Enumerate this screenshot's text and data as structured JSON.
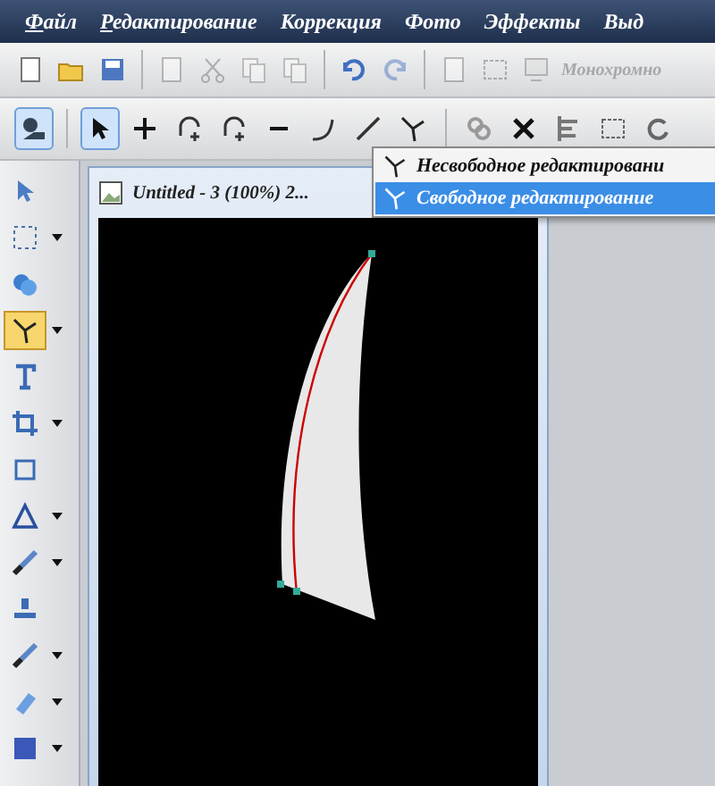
{
  "menu_bar": {
    "items": [
      {
        "accel": "Ф",
        "label": "айл"
      },
      {
        "accel": "Р",
        "label": "едактирование"
      },
      {
        "label": "Коррекция"
      },
      {
        "label": "Фото"
      },
      {
        "label": "Эффекты"
      },
      {
        "label": "Выд"
      }
    ]
  },
  "main_toolbar": {
    "buttons": [
      {
        "kind": "new",
        "disabled": false
      },
      {
        "kind": "open",
        "disabled": false
      },
      {
        "kind": "save",
        "disabled": false
      },
      {
        "kind": "blank",
        "disabled": true
      },
      {
        "kind": "cut",
        "disabled": true
      },
      {
        "kind": "copy",
        "disabled": true
      },
      {
        "kind": "paste",
        "disabled": true
      },
      {
        "kind": "undo",
        "disabled": false
      },
      {
        "kind": "redo",
        "disabled": true
      },
      {
        "kind": "page",
        "disabled": true
      },
      {
        "kind": "frame",
        "disabled": true
      },
      {
        "kind": "monitor",
        "disabled": true
      }
    ],
    "text": "Монохромно"
  },
  "path_toolbar": {
    "buttons": [
      {
        "kind": "mode",
        "selected": true
      },
      {
        "kind": "arrow",
        "selected": true
      },
      {
        "kind": "plus",
        "selected": false
      },
      {
        "kind": "addloop",
        "selected": false
      },
      {
        "kind": "addloop2",
        "selected": false
      },
      {
        "kind": "minus",
        "selected": false
      },
      {
        "kind": "curve",
        "selected": false
      },
      {
        "kind": "line",
        "selected": false
      },
      {
        "kind": "node",
        "selected": false
      },
      {
        "kind": "link",
        "selected": false
      },
      {
        "kind": "delete",
        "selected": false
      },
      {
        "kind": "align",
        "selected": false
      },
      {
        "kind": "select",
        "selected": false
      },
      {
        "kind": "refresh",
        "selected": false
      }
    ]
  },
  "dropdown": {
    "items": [
      {
        "label": "Несвободное редактировани",
        "selected": false
      },
      {
        "label": "Свободное редактирование",
        "selected": true
      }
    ]
  },
  "tools": {
    "items": [
      {
        "kind": "pointer",
        "selected": false,
        "has_menu": false
      },
      {
        "kind": "marquee",
        "selected": false,
        "has_menu": true
      },
      {
        "kind": "shapes",
        "selected": false,
        "has_menu": false
      },
      {
        "kind": "node",
        "selected": true,
        "has_menu": true
      },
      {
        "kind": "text",
        "selected": false,
        "has_menu": false
      },
      {
        "kind": "crop",
        "selected": false,
        "has_menu": true
      },
      {
        "kind": "transform",
        "selected": false,
        "has_menu": false
      },
      {
        "kind": "triangle",
        "selected": false,
        "has_menu": true
      },
      {
        "kind": "brush",
        "selected": false,
        "has_menu": true
      },
      {
        "kind": "stamp",
        "selected": false,
        "has_menu": false
      },
      {
        "kind": "wand",
        "selected": false,
        "has_menu": true
      },
      {
        "kind": "eraser",
        "selected": false,
        "has_menu": true
      },
      {
        "kind": "fill",
        "selected": false,
        "has_menu": true
      }
    ]
  },
  "document": {
    "title": "Untitled - 3 (100%) 2..."
  }
}
